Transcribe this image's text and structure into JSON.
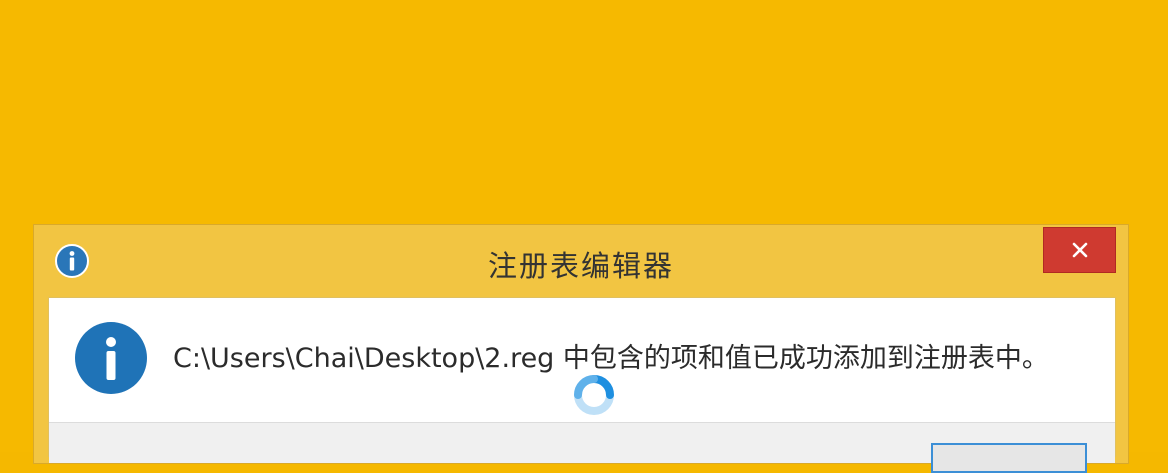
{
  "window": {
    "title": "注册表编辑器",
    "close_glyph": "✕",
    "title_icon": "info-icon"
  },
  "message": {
    "icon": "info-icon",
    "text": "C:\\Users\\Chai\\Desktop\\2.reg 中包含的项和值已成功添加到注册表中。"
  },
  "colors": {
    "desktop": "#f6b900",
    "frame": "#f2c542",
    "close": "#cf3a30",
    "info_blue": "#1f73b7"
  }
}
